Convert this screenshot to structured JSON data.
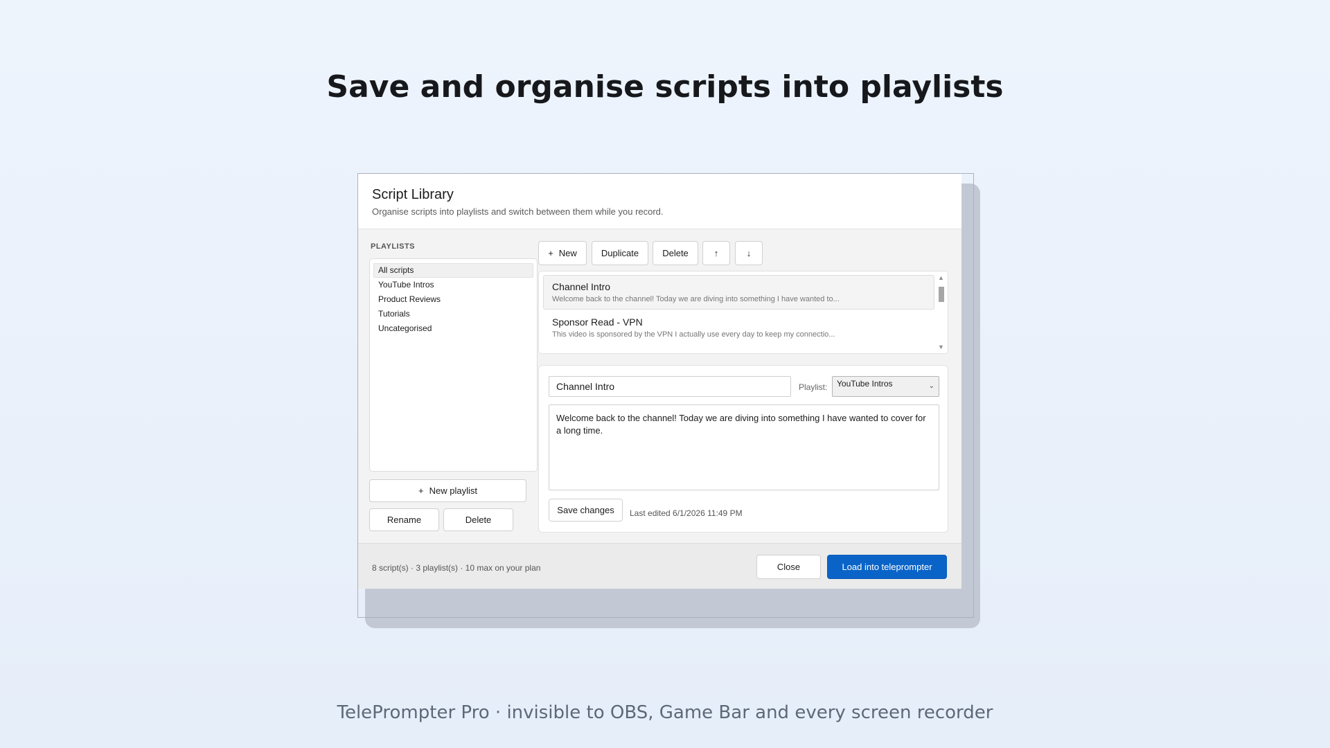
{
  "headline": "Save and organise scripts into playlists",
  "tagline": "TelePrompter Pro  ·  invisible to OBS, Game Bar and every screen recorder",
  "dialog": {
    "title": "Script Library",
    "subtitle": "Organise scripts into playlists and switch between them while you record."
  },
  "playlists": {
    "section_label": "PLAYLISTS",
    "items": [
      {
        "label": "All scripts",
        "selected": true
      },
      {
        "label": "YouTube Intros"
      },
      {
        "label": "Product Reviews"
      },
      {
        "label": "Tutorials"
      },
      {
        "label": "Uncategorised"
      }
    ],
    "new_label": "New playlist",
    "rename_label": "Rename",
    "delete_label": "Delete"
  },
  "toolbar": {
    "new_label": "New",
    "duplicate_label": "Duplicate",
    "delete_label": "Delete",
    "up_label": "↑",
    "down_label": "↓"
  },
  "scripts": [
    {
      "title": "Channel Intro",
      "preview": "Welcome back to the channel! Today we are diving into something I have wanted to...",
      "selected": true
    },
    {
      "title": "Sponsor Read - VPN",
      "preview": "This video is sponsored by the VPN I actually use every day to keep my connectio..."
    }
  ],
  "editor": {
    "name_value": "Channel Intro",
    "playlist_label": "Playlist:",
    "playlist_value": "YouTube Intros",
    "body_value": "Welcome back to the channel! Today we are diving into something I have wanted to cover for a long time.",
    "save_label": "Save changes",
    "last_edited": "Last edited 6/1/2026 11:49 PM"
  },
  "footer": {
    "status": "8 script(s) · 3 playlist(s) · 10 max on your plan",
    "close_label": "Close",
    "load_label": "Load into teleprompter"
  },
  "colors": {
    "accent": "#0a64c8",
    "background": "#eef4fc"
  }
}
